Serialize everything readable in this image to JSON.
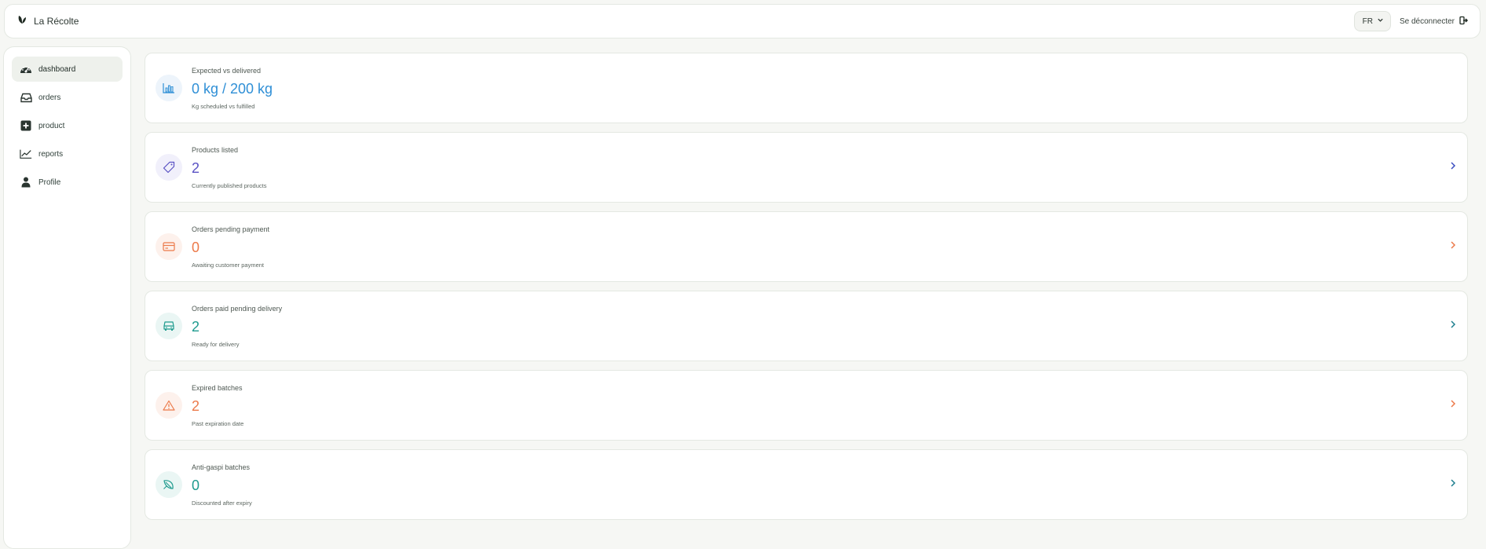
{
  "header": {
    "brand": "La Récolte",
    "language": "FR",
    "logout_label": "Se déconnecter"
  },
  "sidebar": {
    "items": [
      {
        "label": "dashboard",
        "icon": "gauge-icon",
        "active": true
      },
      {
        "label": "orders",
        "icon": "inbox-icon",
        "active": false
      },
      {
        "label": "product",
        "icon": "plus-square-icon",
        "active": false
      },
      {
        "label": "reports",
        "icon": "line-chart-icon",
        "active": false
      },
      {
        "label": "Profile",
        "icon": "user-icon",
        "active": false
      }
    ]
  },
  "cards": [
    {
      "title": "Expected vs delivered",
      "value": "0 kg / 200 kg",
      "subtitle": "Kg scheduled vs fulfilled",
      "icon": "bar-chart-icon",
      "color": "#2f8fd6",
      "bg": "#edf4fb"
    },
    {
      "title": "Products listed",
      "value": "2",
      "subtitle": "Currently published products",
      "icon": "tag-icon",
      "color": "#5a52c4",
      "bg": "#f1f0fb"
    },
    {
      "title": "Orders pending payment",
      "value": "0",
      "subtitle": "Awaiting customer payment",
      "icon": "credit-card-icon",
      "color": "#ec7a4a",
      "bg": "#fdf1ec"
    },
    {
      "title": "Orders paid pending delivery",
      "value": "2",
      "subtitle": "Ready for delivery",
      "icon": "truck-icon",
      "color": "#1e9b8e",
      "bg": "#eaf6f4"
    },
    {
      "title": "Expired batches",
      "value": "2",
      "subtitle": "Past expiration date",
      "icon": "warning-icon",
      "color": "#ec7a4a",
      "bg": "#fdf1ec"
    },
    {
      "title": "Anti-gaspi batches",
      "value": "0",
      "subtitle": "Discounted after expiry",
      "icon": "leaf-icon",
      "color": "#1e9b8e",
      "bg": "#eaf6f4"
    }
  ]
}
